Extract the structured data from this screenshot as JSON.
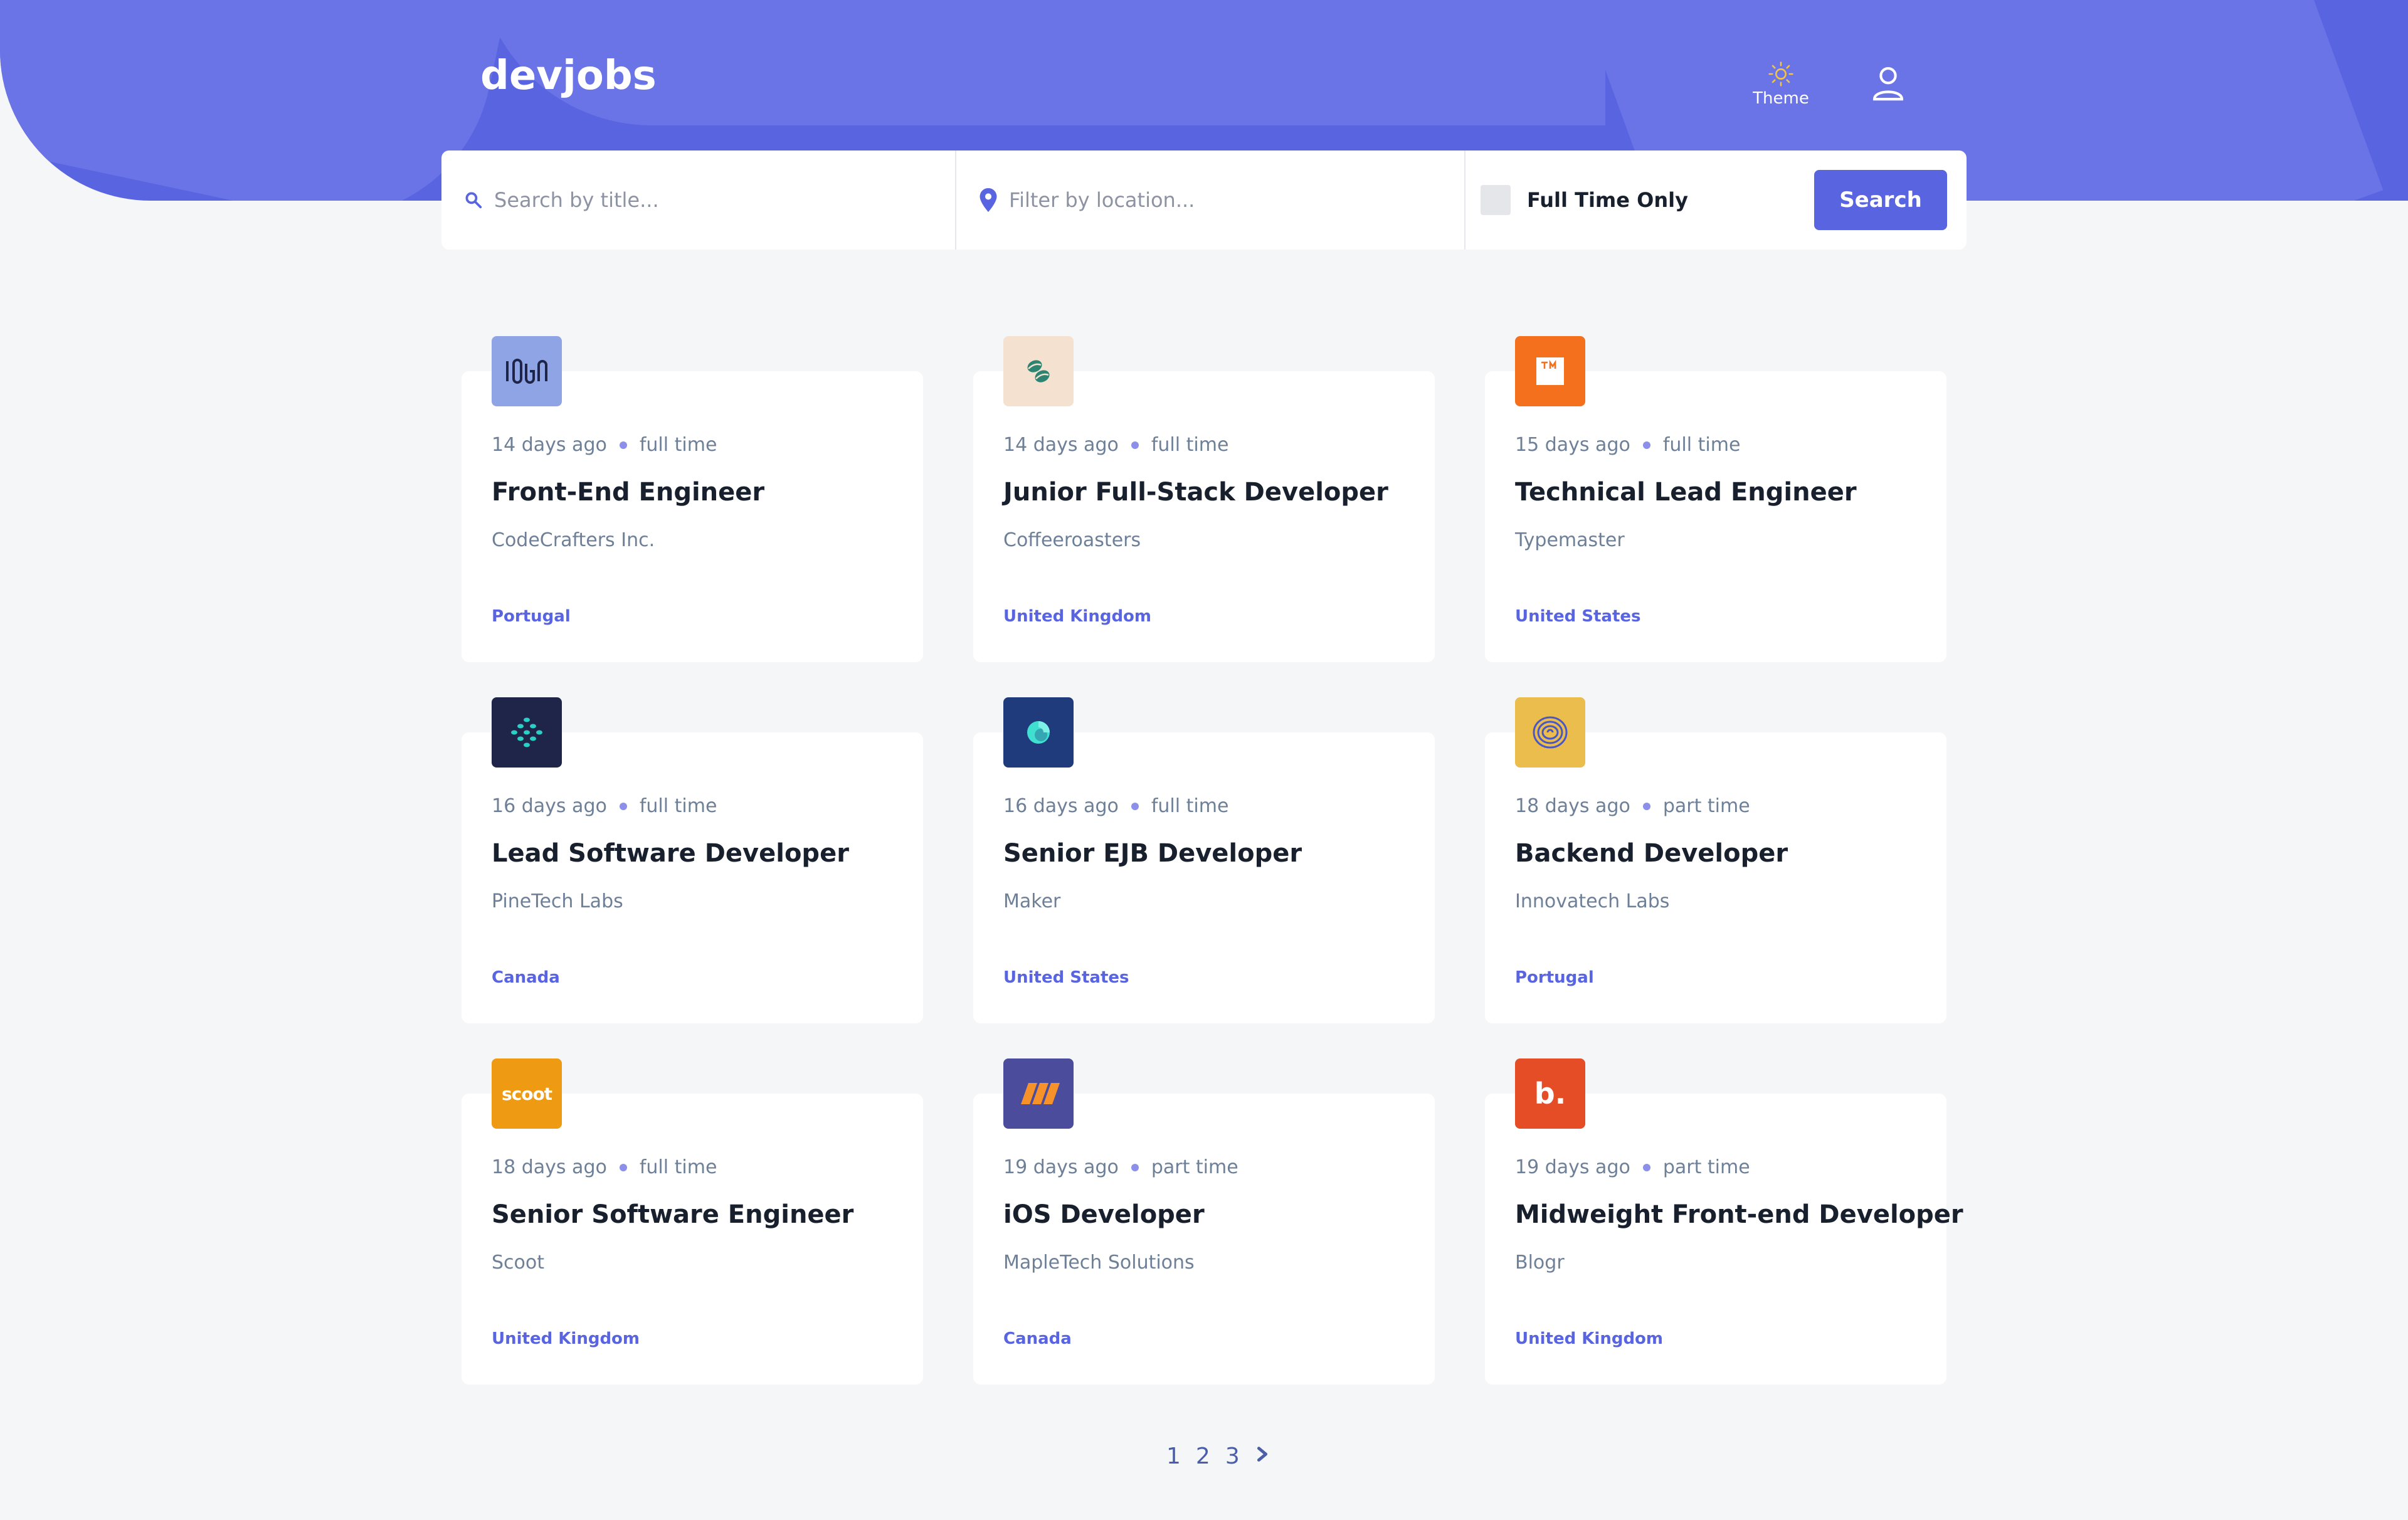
{
  "header": {
    "logo": "devjobs",
    "theme_label": "Theme"
  },
  "search": {
    "title_placeholder": "Search by title...",
    "location_placeholder": "Filter by location...",
    "fulltime_label": "Full Time Only",
    "fulltime_checked": false,
    "button_label": "Search"
  },
  "jobs": [
    {
      "posted": "14 days ago",
      "contract": "full time",
      "title": "Front-End Engineer",
      "company": "CodeCrafters Inc.",
      "location": "Portugal",
      "logo_bg": "#8fa4e4",
      "logo_icon": "codecrafters-logo"
    },
    {
      "posted": "14 days ago",
      "contract": "full time",
      "title": "Junior Full-Stack Developer",
      "company": "Coffeeroasters",
      "location": "United Kingdom",
      "logo_bg": "#f5e1cf",
      "logo_icon": "coffeeroasters-logo"
    },
    {
      "posted": "15 days ago",
      "contract": "full time",
      "title": "Technical Lead Engineer",
      "company": "Typemaster",
      "location": "United States",
      "logo_bg": "#f5701c",
      "logo_icon": "typemaster-logo"
    },
    {
      "posted": "16 days ago",
      "contract": "full time",
      "title": "Lead Software Developer",
      "company": "PineTech Labs",
      "location": "Canada",
      "logo_bg": "#1e2549",
      "logo_icon": "pinetech-logo"
    },
    {
      "posted": "16 days ago",
      "contract": "full time",
      "title": "Senior EJB Developer",
      "company": "Maker",
      "location": "United States",
      "logo_bg": "#1f3b7c",
      "logo_icon": "maker-logo"
    },
    {
      "posted": "18 days ago",
      "contract": "part time",
      "title": "Backend Developer",
      "company": "Innovatech Labs",
      "location": "Portugal",
      "logo_bg": "#ebbd4c",
      "logo_icon": "innovatech-logo"
    },
    {
      "posted": "18 days ago",
      "contract": "full time",
      "title": "Senior Software Engineer",
      "company": "Scoot",
      "location": "United Kingdom",
      "logo_bg": "#ee9a13",
      "logo_icon": "scoot-logo",
      "logo_text": "scoot"
    },
    {
      "posted": "19 days ago",
      "contract": "part time",
      "title": "iOS Developer",
      "company": "MapleTech Solutions",
      "location": "Canada",
      "logo_bg": "#4b4c9c",
      "logo_icon": "mapletech-logo"
    },
    {
      "posted": "19 days ago",
      "contract": "part time",
      "title": "Midweight Front-end Developer",
      "company": "Blogr",
      "location": "United Kingdom",
      "logo_bg": "#e54d26",
      "logo_icon": "blogr-logo",
      "logo_text": "b."
    }
  ],
  "pagination": {
    "pages": [
      "1",
      "2",
      "3"
    ],
    "current": "1"
  },
  "colors": {
    "accent": "#5964e0",
    "background": "#f4f6f8",
    "text_dark": "#19202d",
    "text_muted": "#6e8098"
  }
}
